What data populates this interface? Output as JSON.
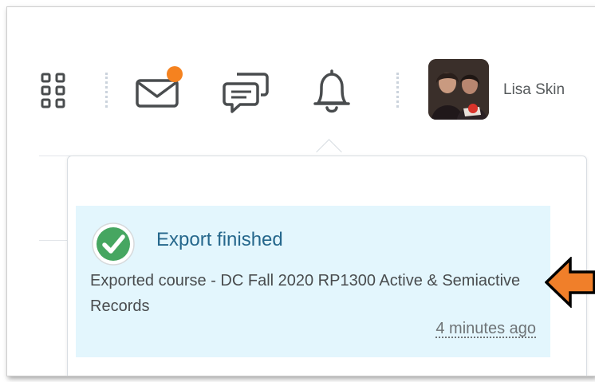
{
  "navbar": {
    "icons": [
      "apps-grid-icon",
      "mail-icon",
      "chat-bubbles-icon",
      "bell-icon"
    ],
    "mail_has_unread": true,
    "unread_dot_color": "#f5821f",
    "user_name": "Lisa Skin"
  },
  "notification": {
    "title": "Export finished",
    "body": "Exported course - DC Fall 2020 RP1300 Active & Semiactive Records",
    "time": "4 minutes ago",
    "background": "#e3f6fd",
    "status_icon": "check-circle-icon"
  },
  "annotation": {
    "arrow_color": "#f07f2a"
  }
}
